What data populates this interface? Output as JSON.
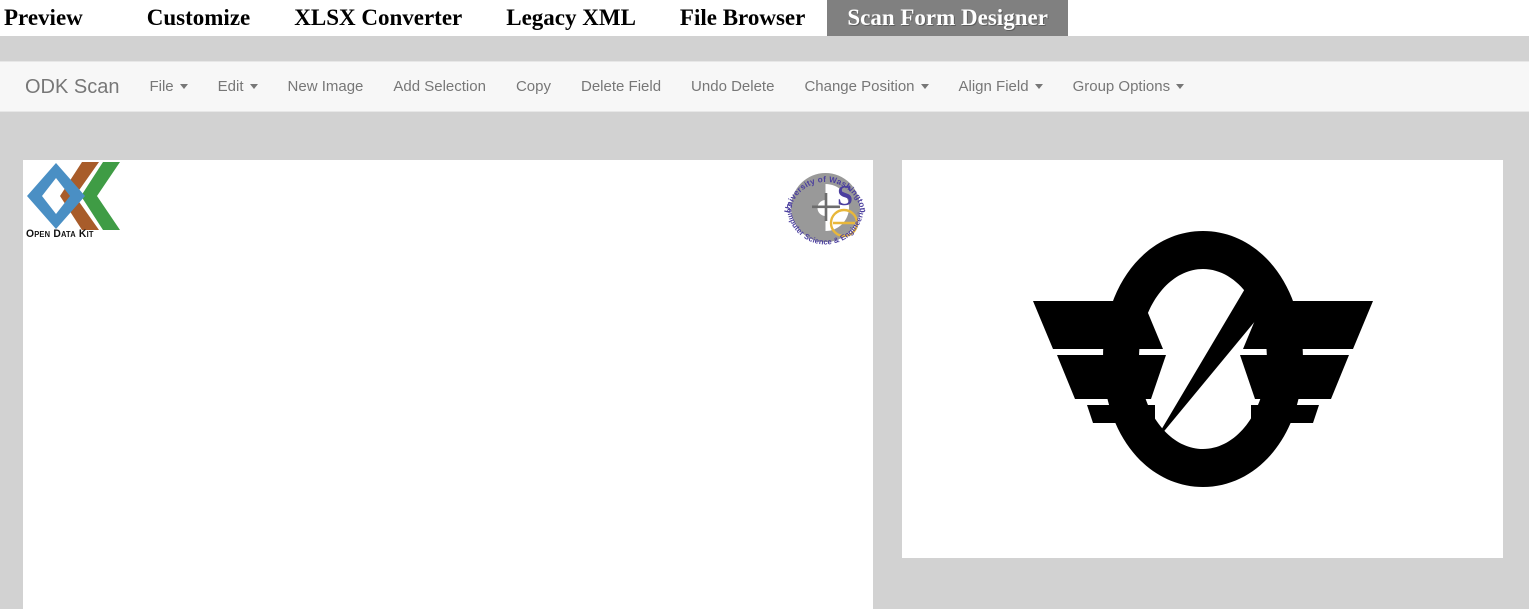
{
  "top_nav": {
    "items": [
      {
        "label": "Preview",
        "active": false
      },
      {
        "label": "Customize",
        "active": false
      },
      {
        "label": "XLSX Converter",
        "active": false
      },
      {
        "label": "Legacy XML",
        "active": false
      },
      {
        "label": "File Browser",
        "active": false
      },
      {
        "label": "Scan Form Designer",
        "active": true
      }
    ]
  },
  "toolbar": {
    "brand": "ODK Scan",
    "items": [
      {
        "label": "File",
        "caret": true
      },
      {
        "label": "Edit",
        "caret": true
      },
      {
        "label": "New Image",
        "caret": false
      },
      {
        "label": "Add Selection",
        "caret": false
      },
      {
        "label": "Copy",
        "caret": false
      },
      {
        "label": "Delete Field",
        "caret": false
      },
      {
        "label": "Undo Delete",
        "caret": false
      },
      {
        "label": "Change Position",
        "caret": true
      },
      {
        "label": "Align Field",
        "caret": true
      },
      {
        "label": "Group Options",
        "caret": true
      }
    ]
  },
  "form_canvas": {
    "odk_logo": {
      "icon": "odk-logo-icon",
      "text": "Open Data Kit",
      "colors": {
        "diamond": "#4a8fc4",
        "chevron_brown": "#a85c2a",
        "chevron_green": "#3f9c45",
        "text": "#111111"
      }
    },
    "uw_logo": {
      "icon": "uw-cse-logo-icon",
      "circular_text_top": "University of Washington",
      "circular_text_bottom": "Computer Science & Engineering",
      "letter_s": "S",
      "letter_e": "e",
      "colors": {
        "disc": "#999999",
        "purple": "#4b3f9e",
        "gold": "#e8b73a"
      }
    }
  },
  "image_panel": {
    "image": {
      "icon": "winged-emblem-icon",
      "description": "Winged circular emblem with diagonal slash",
      "color": "#000000",
      "background": "#ffffff"
    }
  },
  "colors": {
    "page_background": "#d2d2d2",
    "toolbar_background": "#f7f7f7",
    "toolbar_text": "#777777",
    "active_tab_background": "#808080",
    "active_tab_text": "#ffffff",
    "nav_text": "#000000",
    "canvas_background": "#ffffff"
  }
}
